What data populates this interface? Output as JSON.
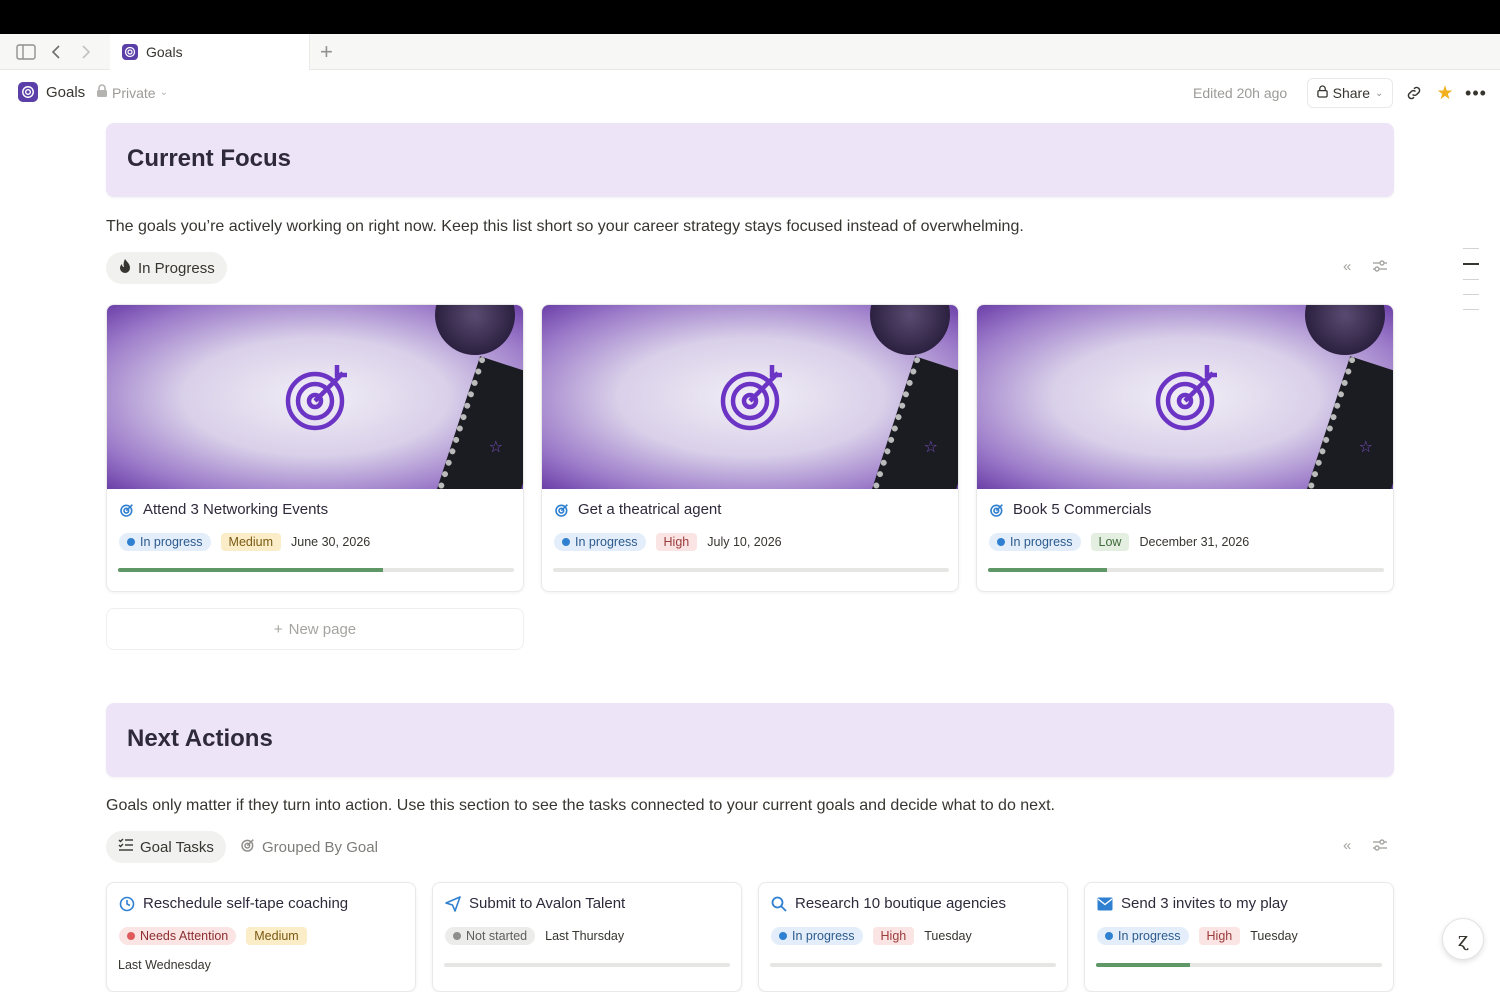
{
  "tabstrip": {
    "tab_title": "Goals",
    "new_tab": "+"
  },
  "header": {
    "page_title": "Goals",
    "visibility": "Private",
    "edited": "Edited 20h ago",
    "share_label": "Share"
  },
  "focus": {
    "title": "Current Focus",
    "description": "The goals you’re actively working on right now. Keep this list short so your career strategy stays focused instead of overwhelming.",
    "view_tab": "In Progress",
    "cards": [
      {
        "title": "Attend 3 Networking Events",
        "status": "In progress",
        "priority": "Medium",
        "date": "June 30, 2026",
        "progress": 0.67
      },
      {
        "title": "Get a theatrical agent",
        "status": "In progress",
        "priority": "High",
        "date": "July 10, 2026",
        "progress": 0
      },
      {
        "title": "Book 5 Commercials",
        "status": "In progress",
        "priority": "Low",
        "date": "December 31, 2026",
        "progress": 0.3
      }
    ],
    "new_page": "New page"
  },
  "next": {
    "title": "Next Actions",
    "description": "Goals only matter if they turn into action. Use this section to see the tasks connected to your current goals and decide what to do next.",
    "view_tabs": [
      "Goal Tasks",
      "Grouped By Goal"
    ],
    "tasks": [
      {
        "title": "Reschedule self-tape coaching",
        "icon": "clock-icon",
        "status": "Needs Attention",
        "priority": "Medium",
        "date": "Last Wednesday"
      },
      {
        "title": "Submit to Avalon Talent",
        "icon": "send-icon",
        "status": "Not started",
        "date": "Last Thursday",
        "progress": 0
      },
      {
        "title": "Research 10 boutique agencies",
        "icon": "magnifier-icon",
        "status": "In progress",
        "priority": "High",
        "date": "Tuesday",
        "progress": 0
      },
      {
        "title": "Send 3 invites to my play",
        "icon": "mail-icon",
        "status": "In progress",
        "priority": "High",
        "date": "Tuesday",
        "progress": 0.33
      }
    ]
  },
  "colors": {
    "banner": "#ede4f8",
    "accent": "#5a3fa8",
    "progress": "#5f9766"
  }
}
